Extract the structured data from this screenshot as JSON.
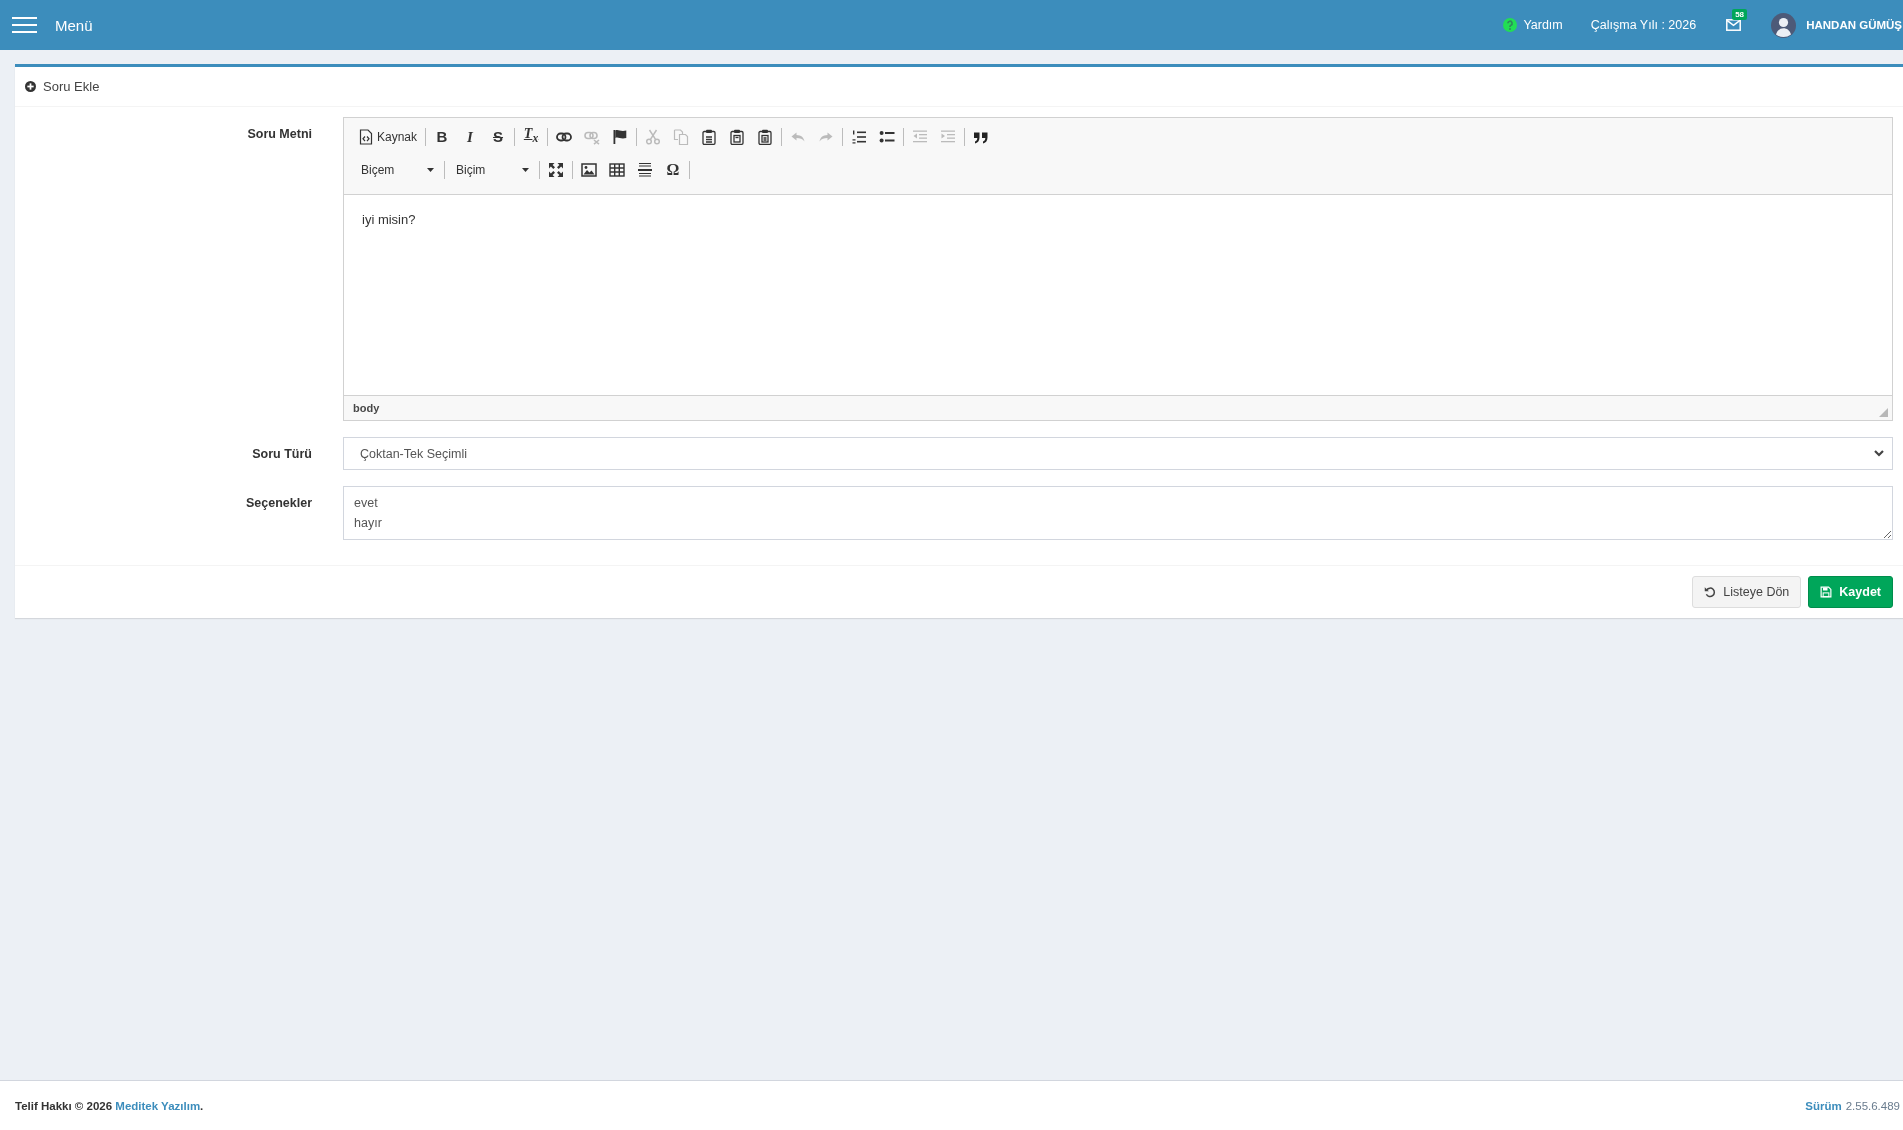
{
  "header": {
    "menu_label": "Menü",
    "help": "Yardım",
    "work_year": "Çalışma Yılı : 2026",
    "mail_badge": "58",
    "user_name": "HANDAN GÜMÜŞ"
  },
  "box": {
    "title": "Soru Ekle",
    "fields": [
      {
        "kind": "editor",
        "label": "Soru Metni",
        "toolbar": [
          {
            "items": [
              {
                "kind": "source",
                "label": "Kaynak",
                "disabled": false
              },
              {
                "kind": "separator"
              },
              {
                "kind": "bold",
                "glyph": "B",
                "disabled": false
              },
              {
                "kind": "italic",
                "glyph": "I",
                "disabled": false
              },
              {
                "kind": "strike",
                "glyph": "S",
                "disabled": false
              },
              {
                "kind": "separator"
              },
              {
                "kind": "removeformat",
                "glyph": "T$_{x}$",
                "disabled": false
              },
              {
                "kind": "separator"
              },
              {
                "kind": "link",
                "disabled": false
              },
              {
                "kind": "unlink",
                "disabled": true
              },
              {
                "kind": "anchor",
                "disabled": false
              },
              {
                "kind": "separator"
              },
              {
                "kind": "cut",
                "disabled": true
              },
              {
                "kind": "copy",
                "disabled": true
              },
              {
                "kind": "paste",
                "disabled": false
              },
              {
                "kind": "pastetext",
                "disabled": false
              },
              {
                "kind": "pasteword",
                "disabled": false
              },
              {
                "kind": "separator"
              },
              {
                "kind": "undo",
                "disabled": true
              },
              {
                "kind": "redo",
                "disabled": true
              },
              {
                "kind": "separator"
              },
              {
                "kind": "numberedlist",
                "disabled": false
              },
              {
                "kind": "bulletedlist",
                "disabled": false
              },
              {
                "kind": "separator"
              },
              {
                "kind": "outdent",
                "disabled": true
              },
              {
                "kind": "indent",
                "disabled": true
              },
              {
                "kind": "separator"
              },
              {
                "kind": "blockquote",
                "disabled": false
              }
            ]
          },
          {
            "items": [
              {
                "kind": "combo",
                "label": "Biçem",
                "disabled": false
              },
              {
                "kind": "separator"
              },
              {
                "kind": "combo",
                "label": "Biçim",
                "disabled": false
              },
              {
                "kind": "separator"
              },
              {
                "kind": "maximize",
                "disabled": false
              },
              {
                "kind": "separator"
              },
              {
                "kind": "image",
                "disabled": false
              },
              {
                "kind": "table",
                "disabled": false
              },
              {
                "kind": "hrule",
                "disabled": false
              },
              {
                "kind": "specialchar",
                "glyph": "Ω",
                "disabled": false
              },
              {
                "kind": "separator"
              }
            ]
          }
        ],
        "content": "iyi misin?",
        "element_path": "body"
      },
      {
        "kind": "select",
        "label": "Soru Türü",
        "value": "Çoktan-Tek Seçimli"
      },
      {
        "kind": "textarea",
        "label": "Seçenekler",
        "value": "evet\nhayır"
      }
    ],
    "buttons": [
      {
        "kind": "back",
        "label": "Listeye Dön"
      },
      {
        "kind": "save",
        "label": "Kaydet"
      }
    ]
  },
  "footer": {
    "copyright": "Telif Hakkı © 2026",
    "company": "Meditek Yazılım",
    "suffix": ".",
    "version_label": "Sürüm",
    "version_number": "2.55.6.489"
  }
}
